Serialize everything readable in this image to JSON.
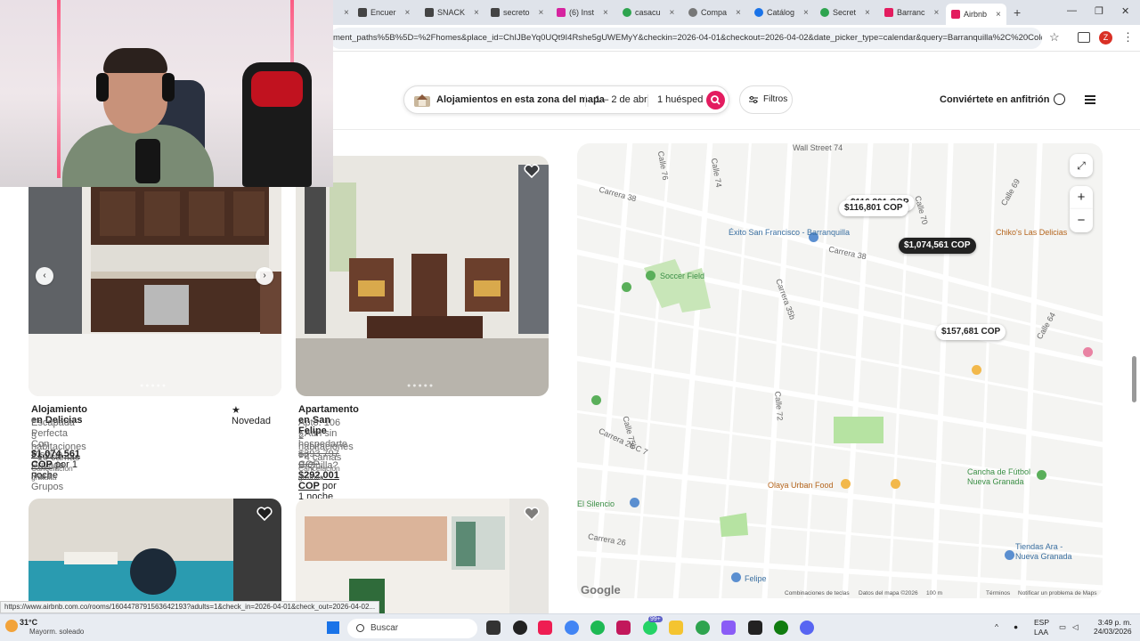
{
  "browser": {
    "tabs": [
      {
        "label": "Encuer",
        "icon": "tiktok-icon"
      },
      {
        "label": "SNACK",
        "icon": "tiktok-icon"
      },
      {
        "label": "secreto",
        "icon": "tiktok-icon"
      },
      {
        "label": "(6) Inst",
        "icon": "instagram-icon"
      },
      {
        "label": "casacu",
        "icon": "green-icon"
      },
      {
        "label": "Compa",
        "icon": "compare-icon"
      },
      {
        "label": "Catálog",
        "icon": "catalog-icon"
      },
      {
        "label": "Secret",
        "icon": "green-icon"
      },
      {
        "label": "Barranc",
        "icon": "airbnb-icon"
      },
      {
        "label": "Airbnb",
        "icon": "airbnb-icon"
      }
    ],
    "url": "ment_paths%5B%5D=%2Fhomes&place_id=ChIJBeYq0UQt9I4Rshe5gUWEMyY&checkin=2026-04-01&checkout=2026-04-02&date_picker_type=calendar&query=Barranquilla%2C%20Colombi...",
    "profile_badge": "Z",
    "status_url": "https://www.airbnb.com.co/rooms/1604478791563642193?adults=1&check_in=2026-04-01&check_out=2026-04-02..."
  },
  "header": {
    "where": "Alojamientos en esta zona del mapa",
    "dates": "1 – 2 de abr",
    "guests": "1 huésped",
    "filters": "Filtros",
    "host": "Conviértete en anfitrión"
  },
  "listings": [
    {
      "title": "Alojamiento en Delicias",
      "rating": "★ Novedad",
      "subtitle": "Escapada Perfecta Con Piscina Privada Para Grupos",
      "rooms": "3 habitaciones · 10 camas",
      "price": "$1,074,561 COP",
      "price_suffix": "por 1 noche",
      "cancel": "Cancelación gratuita"
    },
    {
      "title": "Apartamento en San Felipe",
      "subtitle": "Apto. 106 ¿Aun sin hospedarte en B/Quilla?",
      "rooms": "2 habitaciones · 4 camas",
      "old_price": "$393,797 COP",
      "price": "$292,001 COP",
      "price_suffix": "por 1 noche",
      "cancel": "Cancelación gratuita"
    }
  ],
  "map": {
    "pins": {
      "p1": "$116,801 COP",
      "p1b": "$116,801 COP",
      "p2": "$1,074,561 COP",
      "p3": "$157,681 COP"
    },
    "streets": {
      "wall": "Wall Street 74",
      "c38": "Carrera 38",
      "c38b": "Carrera 38",
      "c35b": "Carrera 35b",
      "c70": "Calle 70",
      "c72": "Calle 72",
      "c74": "Calle 74",
      "c76": "Calle 76",
      "c75b": "Calle 75b",
      "c26": "Carrera 26",
      "c26c": "Carrera 26 C 7",
      "c69": "Calle 69",
      "c64": "Calle 64"
    },
    "pois": {
      "exito": "Éxito San Francisco - Barranquilla",
      "soccer": "Soccer Field",
      "chiko": "Chiko's Las Delicias",
      "olaya": "Olaya Urban Food",
      "cancha": "Cancha de Fútbol Nueva Granada",
      "silencio": "El Silencio",
      "tiendas": "Tiendas Ara - Nueva Granada",
      "felipe": "Felipe"
    },
    "footer": {
      "keys": "Combinaciones de teclas",
      "data": "Datos del mapa ©2026",
      "scale": "100 m",
      "terms": "Términos",
      "report": "Notificar un problema de Maps",
      "logo": "Google"
    }
  },
  "taskbar": {
    "temp": "31°C",
    "weather": "Mayorm. soleado",
    "search": "Buscar",
    "lang1": "ESP",
    "lang2": "LAA",
    "time": "3:49 p. m.",
    "date": "24/03/2026",
    "badge": "99+"
  }
}
